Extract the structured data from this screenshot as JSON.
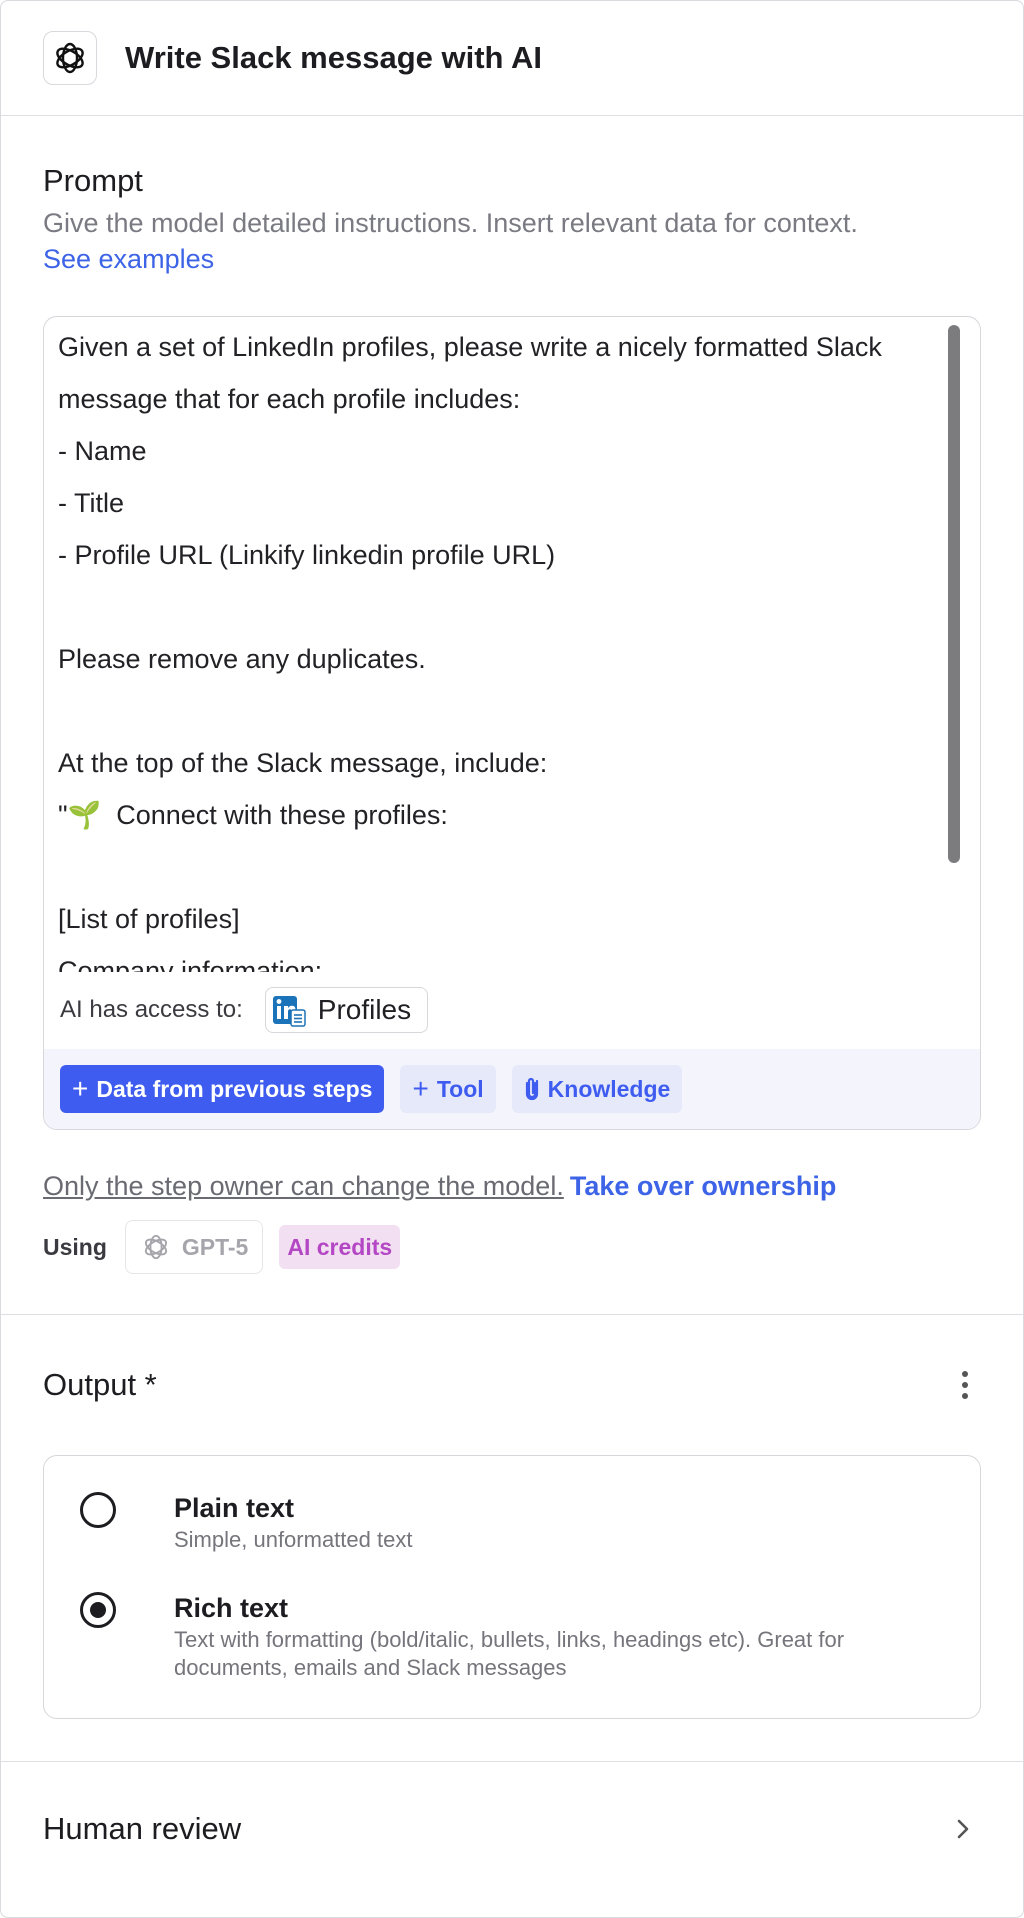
{
  "header": {
    "title": "Write Slack message with AI",
    "icon": "openai-icon"
  },
  "prompt": {
    "label": "Prompt",
    "hint": "Give the model detailed instructions. Insert relevant data for context.",
    "examples_link": "See examples",
    "lines": [
      "Given a set of LinkedIn profiles, please write a nicely formatted Slack",
      "message that for each profile includes:",
      "- Name",
      "- Title",
      "- Profile URL (Linkify linkedin profile URL)",
      "",
      "Please remove any duplicates.",
      "",
      "At the top of the Slack message, include:",
      "\"🌱  Connect with these profiles:",
      "",
      "[List of profiles]",
      "Company information:"
    ],
    "access_label": "AI has access to:",
    "access_chip": "Profiles",
    "buttons": {
      "data": "Data from previous steps",
      "tool": "Tool",
      "knowledge": "Knowledge"
    }
  },
  "model": {
    "owner_text": "Only the step owner can change the model.",
    "owner_link": "Take over ownership",
    "using_label": "Using",
    "model_name": "GPT-5",
    "credits": "AI credits"
  },
  "output": {
    "label": "Output *",
    "options": [
      {
        "title": "Plain text",
        "desc": "Simple, unformatted text",
        "selected": false
      },
      {
        "title": "Rich text",
        "desc": "Text with formatting (bold/italic, bullets, links, headings etc). Great for documents, emails and Slack messages",
        "selected": true
      }
    ]
  },
  "review": {
    "label": "Human review"
  },
  "colors": {
    "accent": "#3f5cf0",
    "link": "#3d63e6",
    "credits_bg": "#f3dff2",
    "credits_fg": "#b347c4"
  }
}
